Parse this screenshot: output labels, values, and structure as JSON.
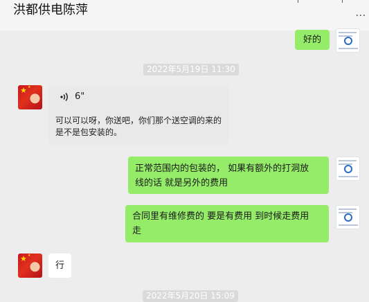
{
  "header": {
    "title": "洪都供电陈萍",
    "more_label": "..."
  },
  "messages": [
    {
      "side": "right",
      "text": "好的"
    },
    {
      "timestamp": "2022年5月19日 11:30"
    },
    {
      "side": "left",
      "voice_duration": "6\"",
      "quote_lines": [
        "可以可以呀，你送吧，你们那个送空调的来的",
        "是不是包安装的。"
      ]
    },
    {
      "side": "right",
      "lines": [
        "正常范围内的包装的， 如果有额外的打洞放",
        "线的话 就是另外的费用"
      ]
    },
    {
      "side": "right",
      "lines": [
        "合同里有维修费的 要是有费用 到时候走费用",
        "走"
      ]
    },
    {
      "side": "left",
      "text": "行"
    },
    {
      "timestamp": "2022年5月20日 15:09"
    }
  ],
  "icons": {
    "voice": "voice-wave-icon",
    "more": "more-dots-icon"
  },
  "colors": {
    "own_bubble": "#95ec69",
    "other_bubble": "#ffffff",
    "background": "#ededed"
  }
}
